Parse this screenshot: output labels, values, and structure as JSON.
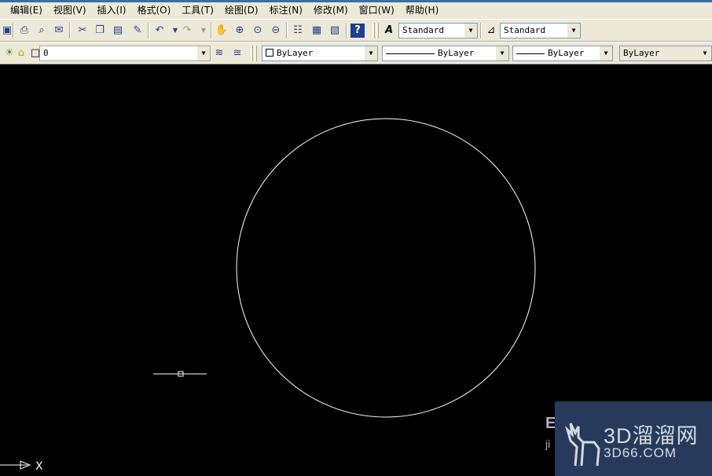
{
  "menu": [
    {
      "id": "edit",
      "label": "编辑(E)"
    },
    {
      "id": "view",
      "label": "视图(V)"
    },
    {
      "id": "insert",
      "label": "插入(I)"
    },
    {
      "id": "format",
      "label": "格式(O)"
    },
    {
      "id": "tools",
      "label": "工具(T)"
    },
    {
      "id": "draw",
      "label": "绘图(D)"
    },
    {
      "id": "dimension",
      "label": "标注(N)"
    },
    {
      "id": "modify",
      "label": "修改(M)"
    },
    {
      "id": "window",
      "label": "窗口(W)"
    },
    {
      "id": "help",
      "label": "帮助(H)"
    }
  ],
  "styles_toolbar": {
    "text_style": "Standard",
    "dim_style": "Standard"
  },
  "layers_toolbar": {
    "current_layer": "0"
  },
  "properties_toolbar": {
    "color": "ByLayer",
    "linetype": "ByLayer",
    "lineweight": "ByLayer",
    "plot_style": "ByLayer"
  },
  "canvas": {
    "background": "#000000",
    "stroke_color": "#ffffff",
    "ucs_x_label": "X"
  },
  "watermark": {
    "brand": "3D溜溜网",
    "site": "3D66.COM",
    "partial_left": "E",
    "partial_left_bottom": "ji"
  }
}
